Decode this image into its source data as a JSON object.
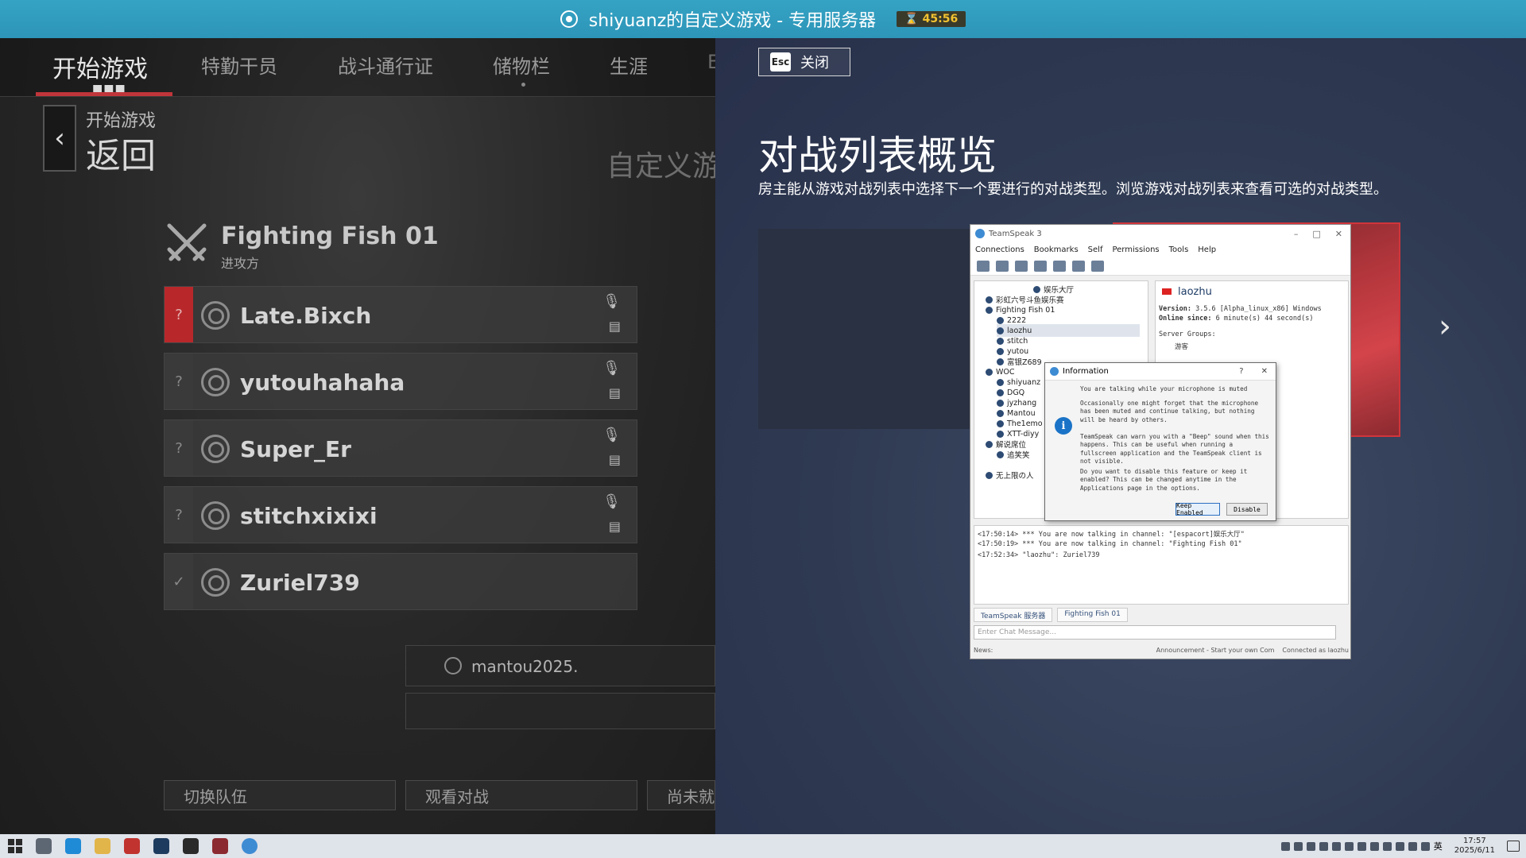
{
  "window": {
    "title": "shiyuanz的自定义游戏 - 专用服务器",
    "timer": "45:56"
  },
  "nav": {
    "tabs": [
      {
        "label": "开始游戏"
      },
      {
        "label": "特勤干员"
      },
      {
        "label": "战斗通行证"
      },
      {
        "label": "储物栏"
      },
      {
        "label": "生涯"
      },
      {
        "label": "E"
      }
    ]
  },
  "back": {
    "sub_label": "开始游戏",
    "main_label": "返回"
  },
  "custom_game_label": "自定义游",
  "team": {
    "name": "Fighting Fish 01",
    "role": "进攻方"
  },
  "players": [
    {
      "status": "?",
      "name": "Late.Bixch"
    },
    {
      "status": "?",
      "name": "yutouhahaha"
    },
    {
      "status": "?",
      "name": "Super_Er"
    },
    {
      "status": "?",
      "name": "stitchxixixi"
    },
    {
      "status": "✓",
      "name": "Zuriel739"
    }
  ],
  "spectator": {
    "name": "mantou2025."
  },
  "bottom_buttons": {
    "switch_team": "切换队伍",
    "spectate": "观看对战",
    "not_ready": "尚未就"
  },
  "overlay": {
    "close_key": "Esc",
    "close_label": "关闭",
    "title": "对战列表概览",
    "description": "房主能从游戏对战列表中选择下一个要进行的对战类型。浏览游戏对战列表来查看可选的对战类型。"
  },
  "teamspeak": {
    "title": "TeamSpeak 3",
    "menu": [
      "Connections",
      "Bookmarks",
      "Self",
      "Permissions",
      "Tools",
      "Help"
    ],
    "tree": [
      {
        "label": "娱乐大厅",
        "indent": 3
      },
      {
        "label": "彩虹六号斗鱼娱乐赛",
        "indent": 1
      },
      {
        "label": "Fighting Fish 01",
        "indent": 1
      },
      {
        "label": "2222",
        "indent": 2
      },
      {
        "label": "laozhu",
        "indent": 2
      },
      {
        "label": "stitch",
        "indent": 2
      },
      {
        "label": "yutou",
        "indent": 2
      },
      {
        "label": "富银Z689",
        "indent": 2
      },
      {
        "label": "WOC",
        "indent": 1
      },
      {
        "label": "shiyuanz",
        "indent": 2
      },
      {
        "label": "DGQ",
        "indent": 2
      },
      {
        "label": "jyzhang",
        "indent": 2
      },
      {
        "label": "Mantou",
        "indent": 2
      },
      {
        "label": "The1emo",
        "indent": 2
      },
      {
        "label": "XTT-diyy",
        "indent": 2
      },
      {
        "label": "解说席位",
        "indent": 1
      },
      {
        "label": "追笑笑",
        "indent": 2
      },
      {
        "label": "",
        "indent": 1
      },
      {
        "label": "无上限の人",
        "indent": 1
      }
    ],
    "selected_user": "laozhu",
    "info": {
      "version_label": "Version:",
      "version_value": "3.5.6 [Alpha_linux_x86] Windows",
      "online_label": "Online since:",
      "online_value": "6 minute(s) 44 second(s)",
      "groups_label": "Server Groups:",
      "group": "游客"
    },
    "chat_lines": [
      "<17:50:14> *** You are now talking in channel: \"[espacort]娱乐大厅\"",
      "<17:50:19> *** You are now talking in channel: \"Fighting Fish 01\"",
      "<17:52:34> \"laozhu\": Zuriel739"
    ],
    "tabs": [
      "TeamSpeak 服务器",
      "Fighting Fish 01"
    ],
    "chat_placeholder": "Enter Chat Message...",
    "status_left": "News:",
    "status_announcement": "Announcement - Start your own Com",
    "status_connected": "Connected as laozhu"
  },
  "dialog": {
    "title": "Information",
    "help": "?",
    "close": "✕",
    "p1": "You are talking while your microphone is muted",
    "p2": "Occasionally one might forget that the microphone has been muted and continue talking, but nothing will be heard by others.",
    "p3": "TeamSpeak can warn you with a \"Beep\" sound when this happens. This can be useful when running a fullscreen application and the TeamSpeak client is not visible.",
    "p4": "Do you want to disable this feature or keep it enabled? This can be changed anytime in the Applications page in the options.",
    "keep_enabled": "Keep Enabled",
    "disable": "Disable"
  },
  "taskbar": {
    "time": "17:57",
    "date": "2025/6/11",
    "ime": "英"
  },
  "colors": {
    "titlebar": "#35a3c4",
    "accent_red": "#c0353a",
    "overlay_bg": "#2f3a52"
  }
}
